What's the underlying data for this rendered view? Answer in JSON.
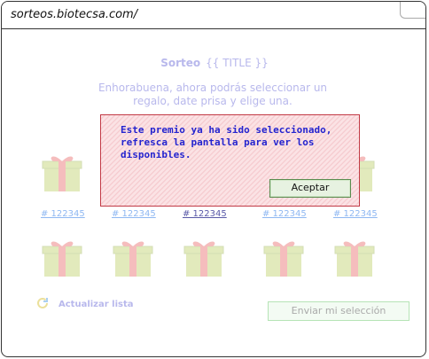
{
  "browser": {
    "url": "sorteos.biotecsa.com/"
  },
  "header": {
    "title_label": "Sorteo",
    "title_value": "{{ TITLE }}",
    "subtitle": "Enhorabuena, ahora podrás seleccionar un regalo, date prisa y elige una."
  },
  "gifts": {
    "row1": [
      {
        "label": "# 122345"
      },
      {
        "label": "# 122345"
      },
      {
        "label": "# 122345"
      },
      {
        "label": "# 122345"
      },
      {
        "label": "# 122345"
      }
    ],
    "row2_count": 5
  },
  "actions": {
    "refresh_label": "Actualizar lista",
    "send_label": "Enviar mi selección"
  },
  "dialog": {
    "message": "Este premio ya ha sido seleccionado, refresca la pantalla para ver los disponibles.",
    "accept_label": "Aceptar"
  },
  "colors": {
    "dialog_border": "#c23a46",
    "dialog_text": "#2424cf",
    "gift_box": "#a8c236",
    "gift_ribbon": "#e33b3b"
  },
  "icons": {
    "gift": "gift-icon",
    "refresh": "refresh-icon"
  }
}
